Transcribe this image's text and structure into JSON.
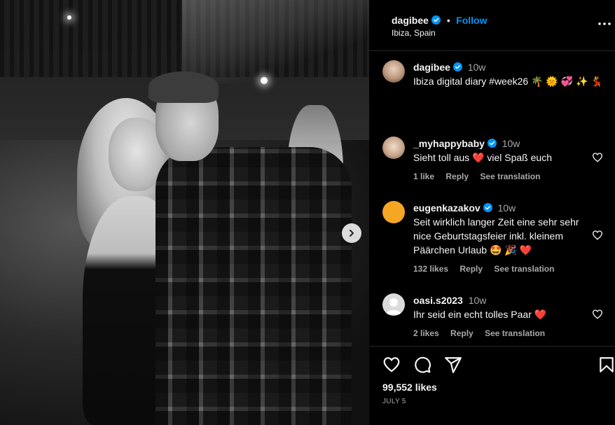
{
  "post": {
    "author": "dagibee",
    "follow_label": "Follow",
    "location": "Ibiza, Spain",
    "caption": {
      "username": "dagibee",
      "time": "10w",
      "text": "Ibiza digital diary #week26 🌴 🌞 💞 ✨ 💃"
    },
    "likes": "99,552 likes",
    "date": "JULY 5"
  },
  "comments": [
    {
      "username": "_myhappybaby",
      "verified": true,
      "time": "10w",
      "text": "Sieht toll aus ❤️ viel Spaß euch",
      "likes": "1 like",
      "reply": "Reply",
      "translate": "See translation"
    },
    {
      "username": "eugenkazakov",
      "verified": true,
      "time": "10w",
      "text": "Seit wirklich langer Zeit eine sehr sehr nice Geburtstagsfeier inkl. kleinem Päärchen Urlaub 🤩 🎉 ❤️",
      "likes": "132 likes",
      "reply": "Reply",
      "translate": "See translation"
    },
    {
      "username": "oasi.s2023",
      "verified": false,
      "time": "10w",
      "text": "Ihr seid ein echt tolles Paar ❤️",
      "likes": "2 likes",
      "reply": "Reply",
      "translate": "See translation"
    }
  ],
  "icons": {
    "verified": "verified-badge-icon",
    "more": "more-options-icon",
    "next": "chevron-right-icon",
    "heart": "heart-icon",
    "comment": "comment-icon",
    "share": "share-icon",
    "save": "bookmark-icon"
  },
  "colors": {
    "accent": "#0095f6",
    "muted": "#a8a8a8",
    "background": "#000000"
  }
}
